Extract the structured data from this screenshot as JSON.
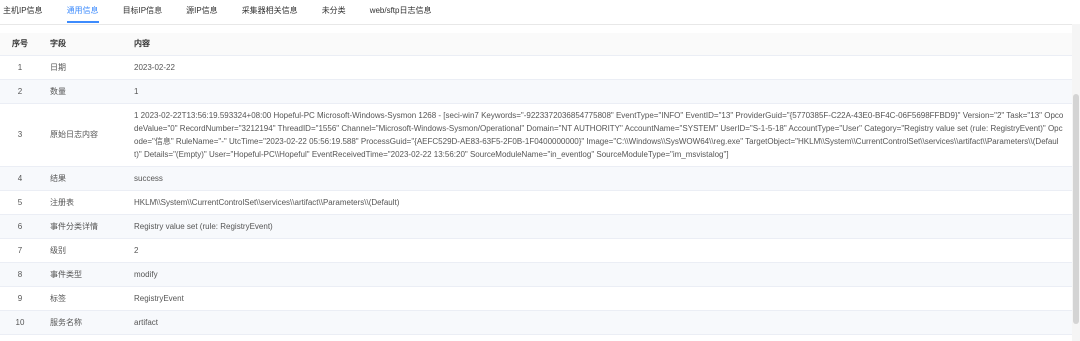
{
  "tabs": [
    {
      "label": "主机IP信息",
      "active": false
    },
    {
      "label": "通用信息",
      "active": true
    },
    {
      "label": "目标IP信息",
      "active": false
    },
    {
      "label": "源IP信息",
      "active": false
    },
    {
      "label": "采集器相关信息",
      "active": false
    },
    {
      "label": "未分类",
      "active": false
    },
    {
      "label": "web/sftp日志信息",
      "active": false
    }
  ],
  "table": {
    "headers": {
      "no": "序号",
      "field": "字段",
      "content": "内容"
    },
    "rows": [
      {
        "no": "1",
        "field": "日期",
        "content": "2023-02-22"
      },
      {
        "no": "2",
        "field": "数量",
        "content": "1"
      },
      {
        "no": "3",
        "field": "原始日志内容",
        "content": "1 2023-02-22T13:56:19.593324+08:00 Hopeful-PC Microsoft-Windows-Sysmon 1268 - [seci-win7 Keywords=\"-9223372036854775808\" EventType=\"INFO\" EventID=\"13\" ProviderGuid=\"{5770385F-C22A-43E0-BF4C-06F5698FFBD9}\" Version=\"2\" Task=\"13\" OpcodeValue=\"0\" RecordNumber=\"3212194\" ThreadID=\"1556\" Channel=\"Microsoft-Windows-Sysmon/Operational\" Domain=\"NT AUTHORITY\" AccountName=\"SYSTEM\" UserID=\"S-1-5-18\" AccountType=\"User\" Category=\"Registry value set (rule: RegistryEvent)\" Opcode=\"信息\" RuleName=\"-\" UtcTime=\"2023-02-22 05:56:19.588\" ProcessGuid=\"{AEFC529D-AE83-63F5-2F0B-1F0400000000}\" Image=\"C:\\\\Windows\\\\SysWOW64\\\\reg.exe\" TargetObject=\"HKLM\\\\System\\\\CurrentControlSet\\\\services\\\\artifact\\\\Parameters\\\\(Default)\" Details=\"(Empty)\" User=\"Hopeful-PC\\\\Hopeful\" EventReceivedTime=\"2023-02-22 13:56:20\" SourceModuleName=\"in_eventlog\" SourceModuleType=\"im_msvistalog\"]"
      },
      {
        "no": "4",
        "field": "结果",
        "content": "success"
      },
      {
        "no": "5",
        "field": "注册表",
        "content": "HKLM\\\\System\\\\CurrentControlSet\\\\services\\\\artifact\\\\Parameters\\\\(Default)"
      },
      {
        "no": "6",
        "field": "事件分类详情",
        "content": "Registry value set (rule: RegistryEvent)"
      },
      {
        "no": "7",
        "field": "级别",
        "content": "2"
      },
      {
        "no": "8",
        "field": "事件类型",
        "content": "modify"
      },
      {
        "no": "9",
        "field": "标签",
        "content": "RegistryEvent"
      },
      {
        "no": "10",
        "field": "服务名称",
        "content": "artifact"
      }
    ]
  },
  "colors": {
    "accent": "#3d8bfd",
    "stripe": "#f7f9fc",
    "border": "#ebeef5"
  }
}
